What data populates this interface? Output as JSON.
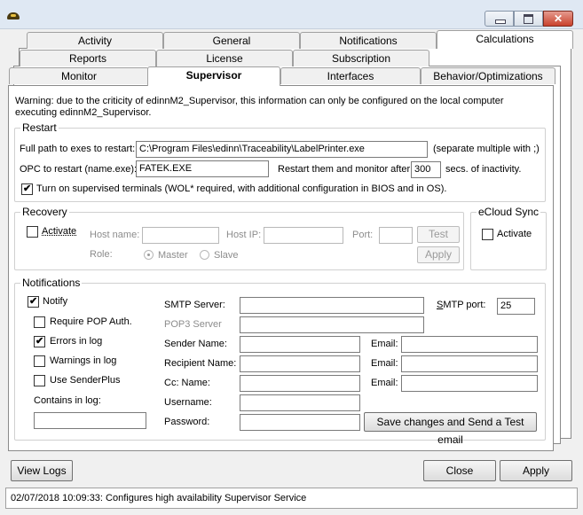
{
  "window": {
    "title": ""
  },
  "tabs": {
    "row1": [
      "Activity",
      "General",
      "Notifications",
      "Calculations"
    ],
    "row2": [
      "Reports",
      "License",
      "Subscription"
    ],
    "row3": [
      "Monitor",
      "Supervisor",
      "Interfaces",
      "Behavior/Optimizations"
    ],
    "active": "Supervisor"
  },
  "supervisor": {
    "warning": "Warning: due to the criticity of edinnM2_Supervisor, this information can only be configured on the local computer executing edinnM2_Supervisor.",
    "restart": {
      "legend": "Restart",
      "path_label": "Full path to exes to restart:",
      "path_value": "C:\\Program Files\\edinn\\Traceability\\LabelPrinter.exe",
      "path_hint": "(separate multiple with ;)",
      "opc_label": "OPC to restart (name.exe):",
      "opc_value": "FATEK.EXE",
      "monitor_label": "Restart them and monitor after:",
      "monitor_value": "300",
      "monitor_unit": "secs. of inactivity.",
      "wol_label": "Turn on supervised terminals (WOL* required, with additional configuration in BIOS and in OS).",
      "wol_checked": true
    },
    "recovery": {
      "legend": "Recovery",
      "activate_label": "Activate",
      "activate_checked": false,
      "host_name_label": "Host name:",
      "host_ip_label": "Host IP:",
      "port_label": "Port:",
      "test_label": "Test",
      "role_label": "Role:",
      "master_label": "Master",
      "slave_label": "Slave",
      "apply_label": "Apply"
    },
    "ecloud": {
      "legend": "eCloud Sync",
      "activate_label": "Activate",
      "activate_checked": false
    },
    "notifications": {
      "legend": "Notifications",
      "notify_label": "Notify",
      "notify_checked": true,
      "require_pop_label": "Require POP Auth.",
      "require_pop_checked": false,
      "errors_label": "Errors in log",
      "errors_checked": true,
      "warnings_label": "Warnings in log",
      "warnings_checked": false,
      "sender_plus_label": "Use SenderPlus",
      "sender_plus_checked": false,
      "contains_label": "Contains in log:",
      "contains_value": "",
      "smtp_server_label": "SMTP Server:",
      "smtp_server_value": "",
      "smtp_port_label": "SMTP port:",
      "smtp_port_value": "25",
      "pop3_label": "POP3 Server",
      "pop3_value": "",
      "sender_name_label": "Sender Name:",
      "recipient_name_label": "Recipient Name:",
      "cc_name_label": "Cc: Name:",
      "username_label": "Username:",
      "password_label": "Password:",
      "email_label": "Email:",
      "save_test_label": "Save changes and Send a Test email"
    }
  },
  "footer": {
    "view_logs_label": "View Logs",
    "close_label": "Close",
    "apply_label": "Apply"
  },
  "status": {
    "text": "02/07/2018 10:09:33: Configures high availability Supervisor Service"
  }
}
